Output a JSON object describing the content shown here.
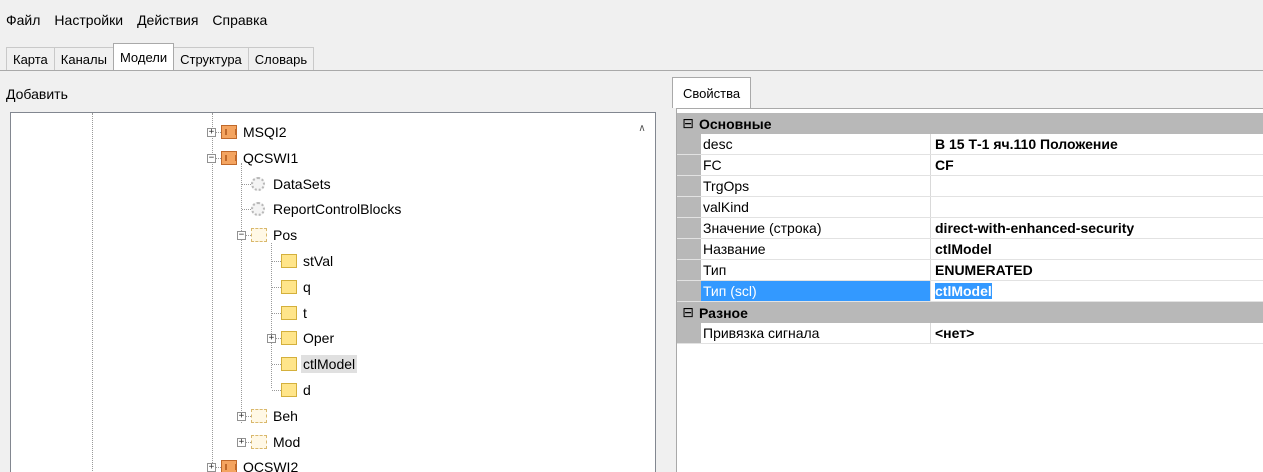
{
  "menu": [
    "Файл",
    "Настройки",
    "Действия",
    "Справка"
  ],
  "tabs": [
    "Карта",
    "Каналы",
    "Модели",
    "Структура",
    "Словарь"
  ],
  "active_tab": "Модели",
  "left_header": "Добавить",
  "tree": [
    {
      "label": "MSQI2",
      "icon": "model-icon",
      "expander": "+"
    },
    {
      "label": "QCSWI1",
      "icon": "model-icon",
      "expander": "−"
    },
    {
      "label": "DataSets",
      "icon": "gear-icon"
    },
    {
      "label": "ReportControlBlocks",
      "icon": "gear-icon"
    },
    {
      "label": "Pos",
      "icon": "dashed-folder-icon",
      "expander": "−"
    },
    {
      "label": "stVal",
      "icon": "folder-icon"
    },
    {
      "label": "q",
      "icon": "folder-icon"
    },
    {
      "label": "t",
      "icon": "folder-icon"
    },
    {
      "label": "Oper",
      "icon": "folder-icon",
      "expander": "+"
    },
    {
      "label": "ctlModel",
      "icon": "folder-icon",
      "selected": true
    },
    {
      "label": "d",
      "icon": "folder-icon"
    },
    {
      "label": "Beh",
      "icon": "dashed-folder-icon",
      "expander": "+"
    },
    {
      "label": "Mod",
      "icon": "dashed-folder-icon",
      "expander": "+"
    },
    {
      "label": "QCSWI2",
      "icon": "model-icon",
      "expander": "+"
    }
  ],
  "props_tab": "Свойства",
  "props": {
    "cat1": {
      "toggle": "⊟",
      "title": "Основные"
    },
    "rows1": [
      {
        "name": "desc",
        "value": "В 15 Т-1 яч.110 Положение"
      },
      {
        "name": "FC",
        "value": "CF"
      },
      {
        "name": "TrgOps",
        "value": ""
      },
      {
        "name": "valKind",
        "value": ""
      },
      {
        "name": "Значение (строка)",
        "value": "direct-with-enhanced-security"
      },
      {
        "name": "Название",
        "value": "ctlModel"
      },
      {
        "name": "Тип",
        "value": "ENUMERATED"
      },
      {
        "name": "Тип (scl)",
        "value": "ctlModel"
      }
    ],
    "cat2": {
      "toggle": "⊟",
      "title": "Разное"
    },
    "rows2": [
      {
        "name": "Привязка сигнала",
        "value": "<нет>"
      }
    ]
  }
}
